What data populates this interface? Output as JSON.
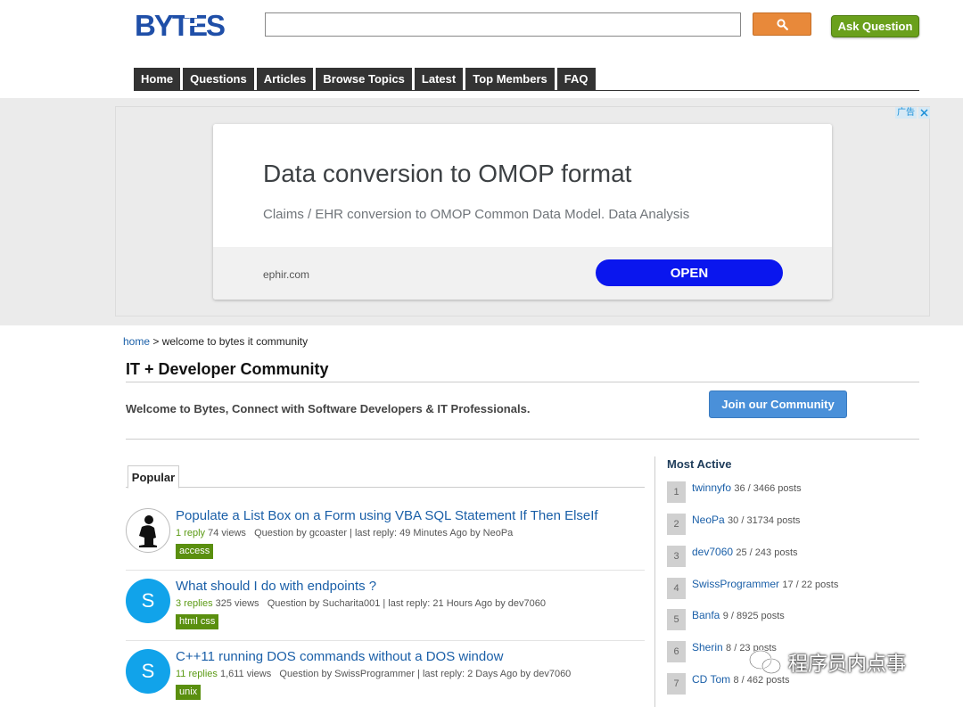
{
  "header": {
    "logo_text": "BYTES",
    "search_value": "",
    "ask_label": "Ask Question"
  },
  "nav": {
    "items": [
      "Home",
      "Questions",
      "Articles",
      "Browse Topics",
      "Latest",
      "Top Members",
      "FAQ"
    ]
  },
  "ad": {
    "label": "广告",
    "title": "Data conversion to OMOP format",
    "subtitle": "Claims / EHR conversion to OMOP Common Data Model. Data Analysis",
    "domain": "ephir.com",
    "cta": "OPEN"
  },
  "breadcrumb": {
    "home": "home",
    "separator": " > ",
    "current": "welcome to bytes it community"
  },
  "community": {
    "title": "IT + Developer Community",
    "welcome": "Welcome to Bytes, Connect with Software Developers & IT Professionals.",
    "join_label": "Join our Community"
  },
  "tabs": {
    "popular": "Popular"
  },
  "questions": [
    {
      "title": "Populate a List Box on a Form using VBA SQL Statement If Then ElseIf",
      "replies": "1 reply",
      "views": "74 views",
      "info": "Question by gcoaster | last reply: 49 Minutes Ago by NeoPa",
      "tag": "access",
      "avatar": ""
    },
    {
      "title": "What should I do with endpoints ?",
      "replies": "3 replies",
      "views": "325 views",
      "info": "Question by Sucharita001 | last reply: 21 Hours Ago by dev7060",
      "tag": "html css",
      "avatar": "S"
    },
    {
      "title": "C++11 running DOS commands without a DOS window",
      "replies": "11 replies",
      "views": "1,611 views",
      "info": "Question by SwissProgrammer | last reply: 2 Days Ago by dev7060",
      "tag": "unix",
      "avatar": "S"
    }
  ],
  "sidebar": {
    "title": "Most Active",
    "members": [
      {
        "rank": "1",
        "name": "twinnyfo",
        "stats": "36 / 3466 posts"
      },
      {
        "rank": "2",
        "name": "NeoPa",
        "stats": "30 / 31734 posts"
      },
      {
        "rank": "3",
        "name": "dev7060",
        "stats": "25 / 243 posts"
      },
      {
        "rank": "4",
        "name": "SwissProgrammer",
        "stats": "17 / 22 posts"
      },
      {
        "rank": "5",
        "name": "Banfa",
        "stats": "9 / 8925 posts"
      },
      {
        "rank": "6",
        "name": "Sherin",
        "stats": "8 / 23 posts"
      },
      {
        "rank": "7",
        "name": "CD Tom",
        "stats": "8 / 462 posts"
      }
    ]
  },
  "watermark": {
    "text": "程序员内点事"
  },
  "colors": {
    "nav_bg": "#333333",
    "search_btn": "#e8893a",
    "ask_btn": "#6aa01c",
    "link": "#1a5fa8",
    "tag_bg": "#5a8f0f",
    "join_btn": "#4a90d9",
    "ad_cta": "#0a16ee",
    "avatar_letter_bg": "#11a3ea"
  }
}
